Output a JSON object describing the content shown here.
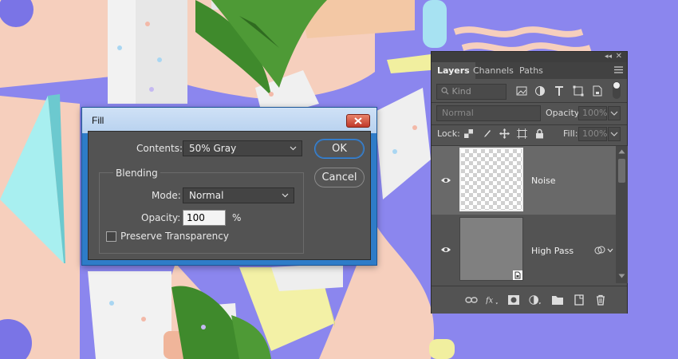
{
  "dialog": {
    "title": "Fill",
    "contents_label": "Contents:",
    "contents_value": "50% Gray",
    "ok_label": "OK",
    "cancel_label": "Cancel",
    "blending_legend": "Blending",
    "mode_label": "Mode:",
    "mode_value": "Normal",
    "opacity_label": "Opacity:",
    "opacity_value": "100",
    "opacity_unit": "%",
    "preserve_label": "Preserve Transparency",
    "preserve_checked": false
  },
  "layers_panel": {
    "tabs": [
      {
        "label": "Layers",
        "active": true
      },
      {
        "label": "Channels",
        "active": false
      },
      {
        "label": "Paths",
        "active": false
      }
    ],
    "filter_kind": "Kind",
    "blend_mode": "Normal",
    "opacity_label": "Opacity:",
    "opacity_value": "100%",
    "lock_label": "Lock:",
    "fill_label": "Fill:",
    "fill_value": "100%",
    "layers": [
      {
        "name": "Noise",
        "selected": true,
        "visible": true
      },
      {
        "name": "High Pass",
        "selected": false,
        "visible": true
      }
    ]
  },
  "colors": {
    "dialog_bg": "#535353",
    "titlebar": "#cfe1f6",
    "accent_blue": "#3b87d9",
    "close_red": "#c0392b"
  }
}
